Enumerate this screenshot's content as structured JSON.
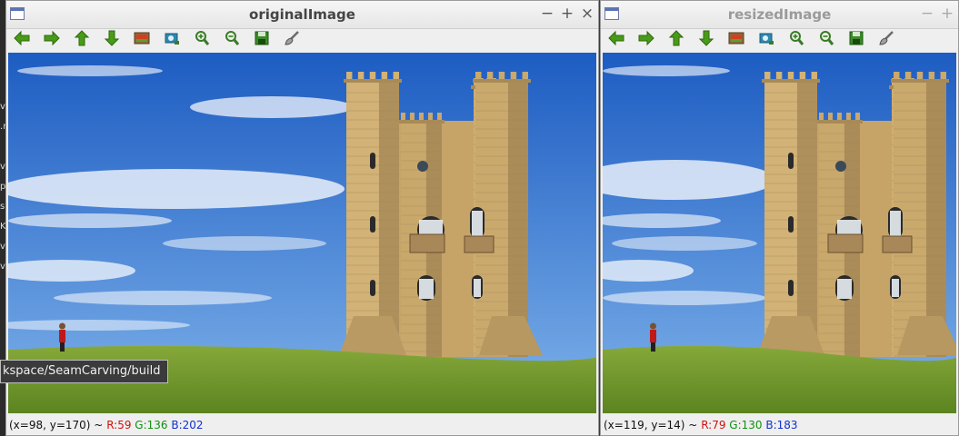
{
  "background_terminal": {
    "fragments": [
      "ve",
      ".n",
      "ve",
      "p",
      "si",
      "KS",
      "ve",
      "ve"
    ]
  },
  "tooltip": {
    "text": "kspace/SeamCarving/build"
  },
  "windows": [
    {
      "title": "originalImage",
      "controls": {
        "minimize": "−",
        "maximize": "+",
        "close": "×"
      },
      "toolbar": [
        "pan-left-icon",
        "pan-right-icon",
        "pan-up-icon",
        "pan-down-icon",
        "zoom-fit-icon",
        "zoom-actual-icon",
        "zoom-in-icon",
        "zoom-out-icon",
        "save-icon",
        "properties-brush-icon"
      ],
      "status": {
        "coords": "(x=98, y=170) ~",
        "r": "R:59",
        "g": "G:136",
        "b": "B:202"
      }
    },
    {
      "title": "resizedImage",
      "controls": {
        "minimize": "−",
        "maximize": "+",
        "close": ""
      },
      "toolbar": [
        "pan-left-icon",
        "pan-right-icon",
        "pan-up-icon",
        "pan-down-icon",
        "zoom-fit-icon",
        "zoom-actual-icon",
        "zoom-in-icon",
        "zoom-out-icon",
        "save-icon",
        "properties-brush-icon"
      ],
      "status": {
        "coords": "(x=119, y=14) ~",
        "r": "R:79",
        "g": "G:130",
        "b": "B:183"
      }
    }
  ],
  "colors": {
    "sky_top": "#1e5fc4",
    "sky_bottom": "#6ea7e6",
    "grass": "#6f9a2c",
    "stone": "#c8a56a",
    "red": "#d01010",
    "green": "#109010",
    "blue": "#1030d0"
  }
}
